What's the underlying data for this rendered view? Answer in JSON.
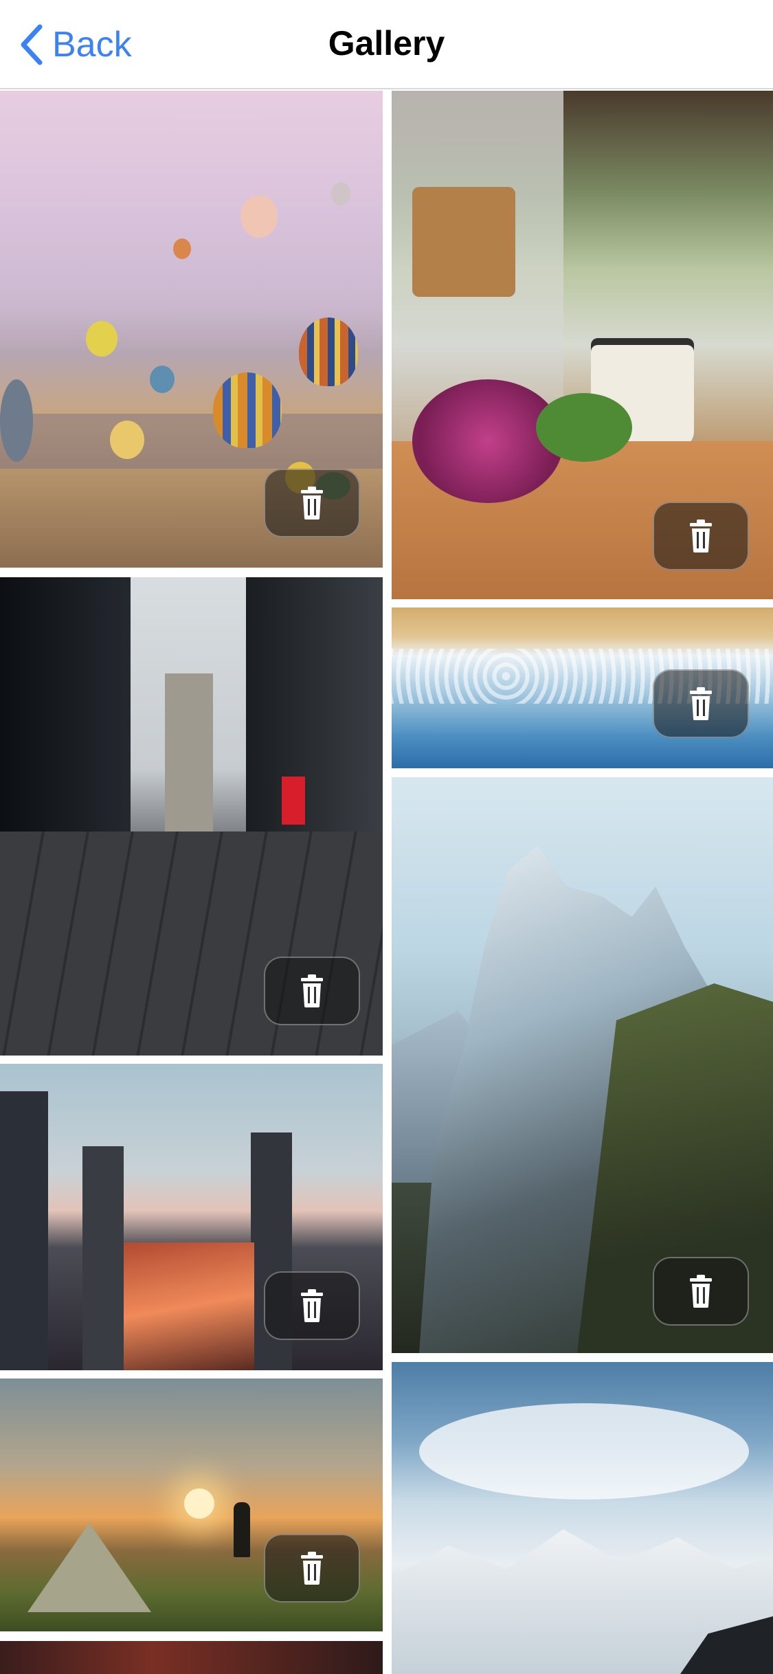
{
  "nav": {
    "back_label": "Back",
    "title": "Gallery",
    "back_icon": "chevron-left-icon",
    "accent_color": "#3b82f6"
  },
  "photos": [
    {
      "subject": "hot-air-balloons",
      "column": "left",
      "has_delete": true
    },
    {
      "subject": "coffee-and-flowers",
      "column": "right",
      "has_delete": true
    },
    {
      "subject": "ocean-waves",
      "column": "right",
      "has_delete": true
    },
    {
      "subject": "city-street-tower",
      "column": "left",
      "has_delete": true
    },
    {
      "subject": "mountain-cliff",
      "column": "right",
      "has_delete": true
    },
    {
      "subject": "city-skyline-night",
      "column": "left",
      "has_delete": true
    },
    {
      "subject": "tent-sunrise",
      "column": "left",
      "has_delete": true
    },
    {
      "subject": "snowy-mountains-cockpit",
      "column": "right",
      "has_delete": false
    },
    {
      "subject": "partial-photo",
      "column": "left",
      "has_delete": false
    }
  ],
  "delete_icon": "trash-icon"
}
